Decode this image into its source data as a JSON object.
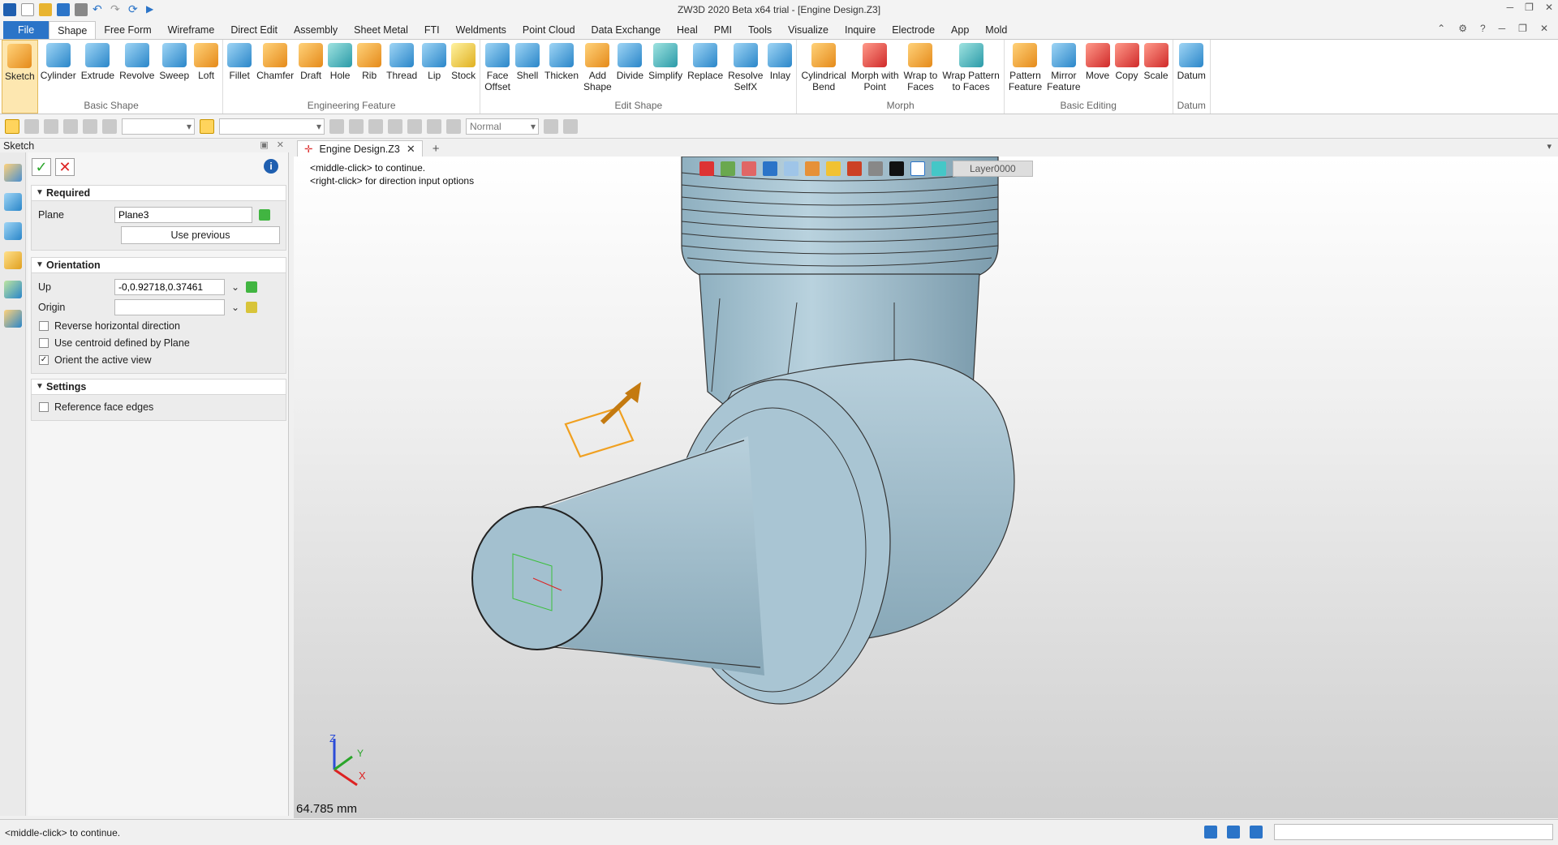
{
  "window": {
    "title": "ZW3D 2020 Beta x64 trial - [Engine Design.Z3]"
  },
  "menu": {
    "tabs": [
      "File",
      "Shape",
      "Free Form",
      "Wireframe",
      "Direct Edit",
      "Assembly",
      "Sheet Metal",
      "FTI",
      "Weldments",
      "Point Cloud",
      "Data Exchange",
      "Heal",
      "PMI",
      "Tools",
      "Visualize",
      "Inquire",
      "Electrode",
      "App",
      "Mold"
    ],
    "active": "Shape"
  },
  "ribbon": {
    "groups": [
      {
        "label": "Basic Shape",
        "buttons": [
          [
            "Sketch",
            "",
            true,
            "ic-orange"
          ],
          [
            "Cylinder",
            "",
            "",
            "ic-blue"
          ],
          [
            "Extrude",
            "",
            "",
            "ic-blue"
          ],
          [
            "Revolve",
            "",
            "",
            "ic-blue"
          ],
          [
            "Sweep",
            "",
            "",
            "ic-blue"
          ],
          [
            "Loft",
            "",
            "",
            "ic-orange"
          ]
        ]
      },
      {
        "label": "Engineering Feature",
        "buttons": [
          [
            "Fillet",
            "",
            "",
            "ic-blue"
          ],
          [
            "Chamfer",
            "",
            "",
            "ic-orange"
          ],
          [
            "Draft",
            "",
            "",
            "ic-orange"
          ],
          [
            "Hole",
            "",
            "",
            "ic-teal"
          ],
          [
            "Rib",
            "",
            "",
            "ic-orange"
          ],
          [
            "Thread",
            "",
            "",
            "ic-blue"
          ],
          [
            "Lip",
            "",
            "",
            "ic-blue"
          ],
          [
            "Stock",
            "",
            "",
            "ic-yellow"
          ]
        ]
      },
      {
        "label": "Edit Shape",
        "buttons": [
          [
            "Face",
            "Offset",
            "",
            "ic-blue"
          ],
          [
            "Shell",
            "",
            "",
            "ic-blue"
          ],
          [
            "Thicken",
            "",
            "",
            "ic-blue"
          ],
          [
            "Add",
            "Shape",
            "",
            "ic-orange"
          ],
          [
            "Divide",
            "",
            "",
            "ic-blue"
          ],
          [
            "Simplify",
            "",
            "",
            "ic-teal"
          ],
          [
            "Replace",
            "",
            "",
            "ic-blue"
          ],
          [
            "Resolve",
            "SelfX",
            "",
            "ic-blue"
          ],
          [
            "Inlay",
            "",
            "",
            "ic-blue"
          ]
        ]
      },
      {
        "label": "Morph",
        "buttons": [
          [
            "Cylindrical",
            "Bend",
            "",
            "ic-orange"
          ],
          [
            "Morph with",
            "Point",
            "",
            "ic-red"
          ],
          [
            "Wrap to",
            "Faces",
            "",
            "ic-orange"
          ],
          [
            "Wrap Pattern",
            "to Faces",
            "",
            "ic-teal"
          ]
        ]
      },
      {
        "label": "Basic Editing",
        "buttons": [
          [
            "Pattern",
            "Feature",
            "",
            "ic-orange"
          ],
          [
            "Mirror",
            "Feature",
            "",
            "ic-blue"
          ],
          [
            "Move",
            "",
            "",
            "ic-red"
          ],
          [
            "Copy",
            "",
            "",
            "ic-red"
          ],
          [
            "Scale",
            "",
            "",
            "ic-red"
          ]
        ]
      },
      {
        "label": "Datum",
        "buttons": [
          [
            "Datum",
            "",
            "",
            "ic-blue"
          ]
        ]
      }
    ]
  },
  "toolbar2": {
    "render_mode": "Normal"
  },
  "panel": {
    "title": "Sketch",
    "required": {
      "label": "Required",
      "plane_label": "Plane",
      "plane_value": "Plane3",
      "use_previous": "Use previous"
    },
    "orientation": {
      "label": "Orientation",
      "up_label": "Up",
      "up_value": "-0,0.92718,0.37461",
      "origin_label": "Origin",
      "origin_value": "",
      "reverse_label": "Reverse horizontal direction",
      "centroid_label": "Use centroid defined by Plane",
      "orient_label": "Orient the active view"
    },
    "settings": {
      "label": "Settings",
      "ref_label": "Reference face edges"
    }
  },
  "doc": {
    "tab": "Engine Design.Z3"
  },
  "viewport": {
    "prompt_line1": "<middle-click> to continue.",
    "prompt_line2": "<right-click> for direction input options",
    "layer": "Layer0000",
    "measure": "64.785 mm",
    "axis": {
      "z": "Z",
      "y": "Y",
      "x": "X"
    }
  },
  "status": {
    "text": "<middle-click> to continue."
  },
  "colors": {
    "file_tab": "#2b74c8",
    "model": "#a9c5d3",
    "plane": "#f0a020"
  }
}
